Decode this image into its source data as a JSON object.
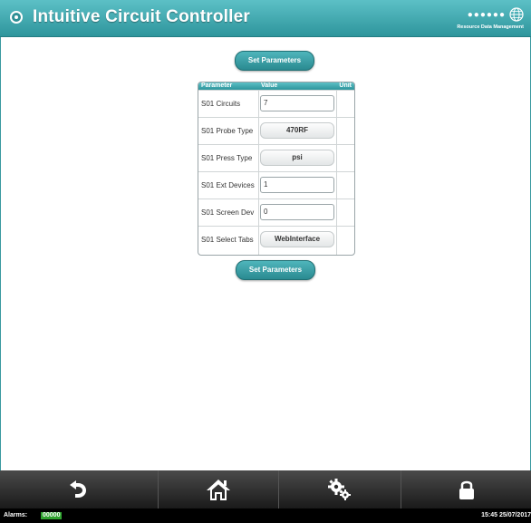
{
  "header": {
    "title": "Intuitive Circuit Controller",
    "brand": "Resource Data Management",
    "brand_logo": "dots-globe-logo"
  },
  "actions": {
    "set_parameters_top": "Set Parameters",
    "set_parameters_bottom": "Set Parameters"
  },
  "table": {
    "columns": [
      "Parameter",
      "Value",
      "Unit"
    ],
    "rows": [
      {
        "label": "S01 Circuits",
        "value": "7",
        "kind": "input"
      },
      {
        "label": "S01 Probe Type",
        "value": "470RF",
        "kind": "select"
      },
      {
        "label": "S01 Press Type",
        "value": "psi",
        "kind": "select"
      },
      {
        "label": "S01 Ext Devices",
        "value": "1",
        "kind": "input"
      },
      {
        "label": "S01 Screen Dev",
        "value": "0",
        "kind": "input"
      },
      {
        "label": "S01 Select Tabs",
        "value": "WebInterface",
        "kind": "select"
      }
    ]
  },
  "nav": {
    "items": [
      "back-icon",
      "home-icon",
      "settings-icon",
      "lock-icon"
    ]
  },
  "status": {
    "alarms_label": "Alarms:",
    "alarms_count": "00000",
    "datetime": "15:45 25/07/2017"
  },
  "colors": {
    "accent": "#2e959c",
    "alarm_ok": "#2fa32f",
    "bar_dark": "#1a1a1a"
  }
}
